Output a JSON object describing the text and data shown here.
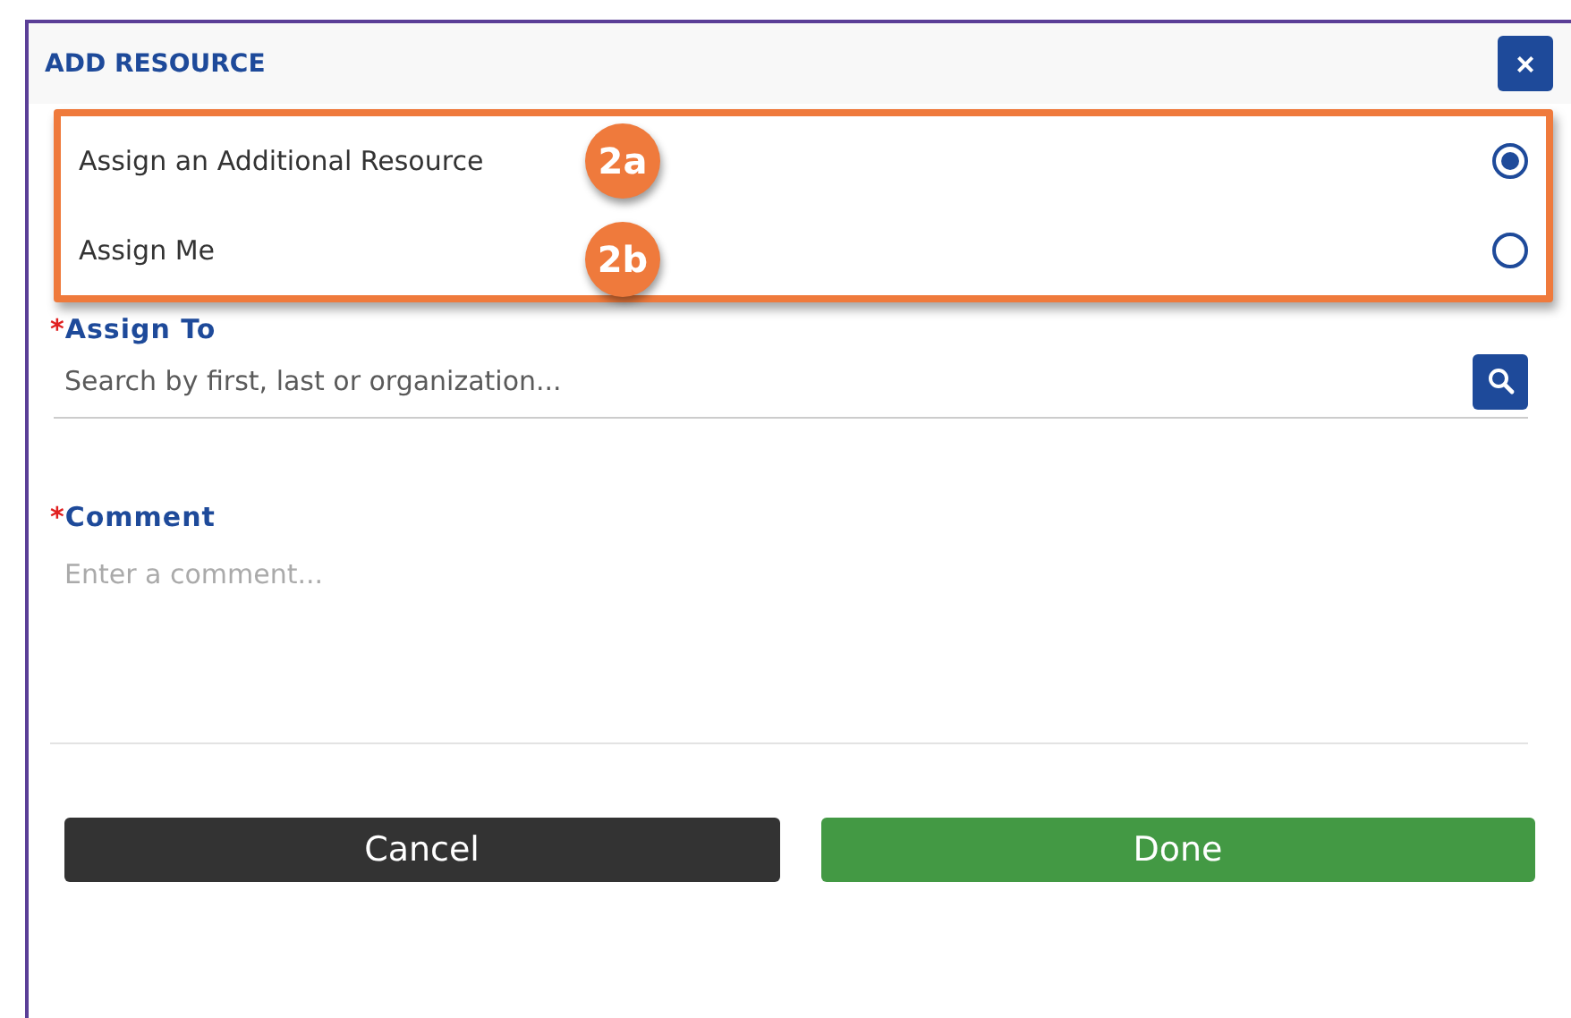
{
  "dialog": {
    "title": "ADD RESOURCE",
    "close": "×"
  },
  "options": [
    {
      "label": "Assign an Additional Resource",
      "selected": true,
      "badge": "2a"
    },
    {
      "label": "Assign Me",
      "selected": false,
      "badge": "2b"
    }
  ],
  "assign_to": {
    "required": "*",
    "label": "Assign To",
    "placeholder": "Search by first, last or organization..."
  },
  "comment": {
    "required": "*",
    "label": "Comment",
    "placeholder": "Enter a comment..."
  },
  "buttons": [
    {
      "label": "Cancel",
      "kind": "secondary"
    },
    {
      "label": "Done",
      "kind": "primary"
    }
  ]
}
